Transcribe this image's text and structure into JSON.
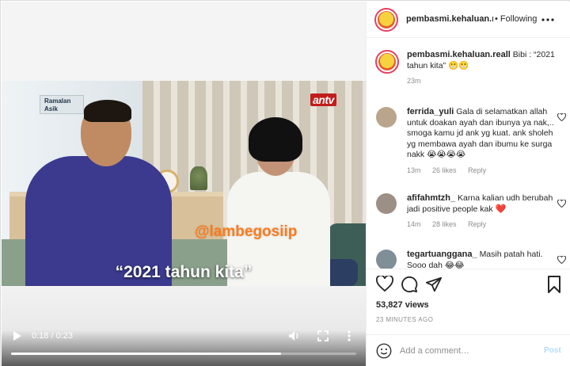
{
  "post": {
    "account": "pembasmi.kehaluan.re",
    "follow_status": "Following",
    "more_label": "•••",
    "caption_user": "pembasmi.kehaluan.reall",
    "caption_text": "Bibi : “2021 tahun kita”",
    "caption_emoji": "😬😬",
    "caption_time": "23m"
  },
  "video": {
    "show_logo": "Ramalan Asik",
    "channel_logo": "antv",
    "watermark": "@lambegosiip",
    "subtitle": "“2021 tahun kita”",
    "time_display": "0:18 / 0:23",
    "progress_fraction": 0.783
  },
  "comments": [
    {
      "user": "ferrida_yuli",
      "text": "Gala di selamatkan allah untuk doakan ayah dan ibunya ya nak,.. smoga kamu jd ank yg kuat. ank sholeh yg membawa ayah dan ibumu ke surga nakk",
      "emoji": "😭😭😭😭",
      "time": "13m",
      "likes": "26 likes",
      "reply": "Reply"
    },
    {
      "user": "afifahmtzh_",
      "text": "Karna kalian udh berubah jadi positive people kak",
      "emoji": "❤️",
      "time": "14m",
      "likes": "28 likes",
      "reply": "Reply"
    },
    {
      "user": "tegartuanggana_",
      "text": "Masih patah hati. Sooo dah",
      "emoji": "😂😂",
      "time": "",
      "likes": "",
      "reply": ""
    }
  ],
  "stats": {
    "views": "53,827 views",
    "posted": "23 MINUTES AGO"
  },
  "comment_box": {
    "placeholder": "Add a comment…",
    "post_label": "Post"
  },
  "colors": {
    "accent_ring": "#e4405f",
    "post_disabled": "#b3dbff",
    "watermark": "#ff7a1a"
  },
  "icons": [
    "play-icon",
    "volume-icon",
    "fullscreen-icon",
    "more-vertical-icon",
    "heart-icon",
    "comment-icon",
    "share-icon",
    "bookmark-icon",
    "emoji-icon"
  ]
}
